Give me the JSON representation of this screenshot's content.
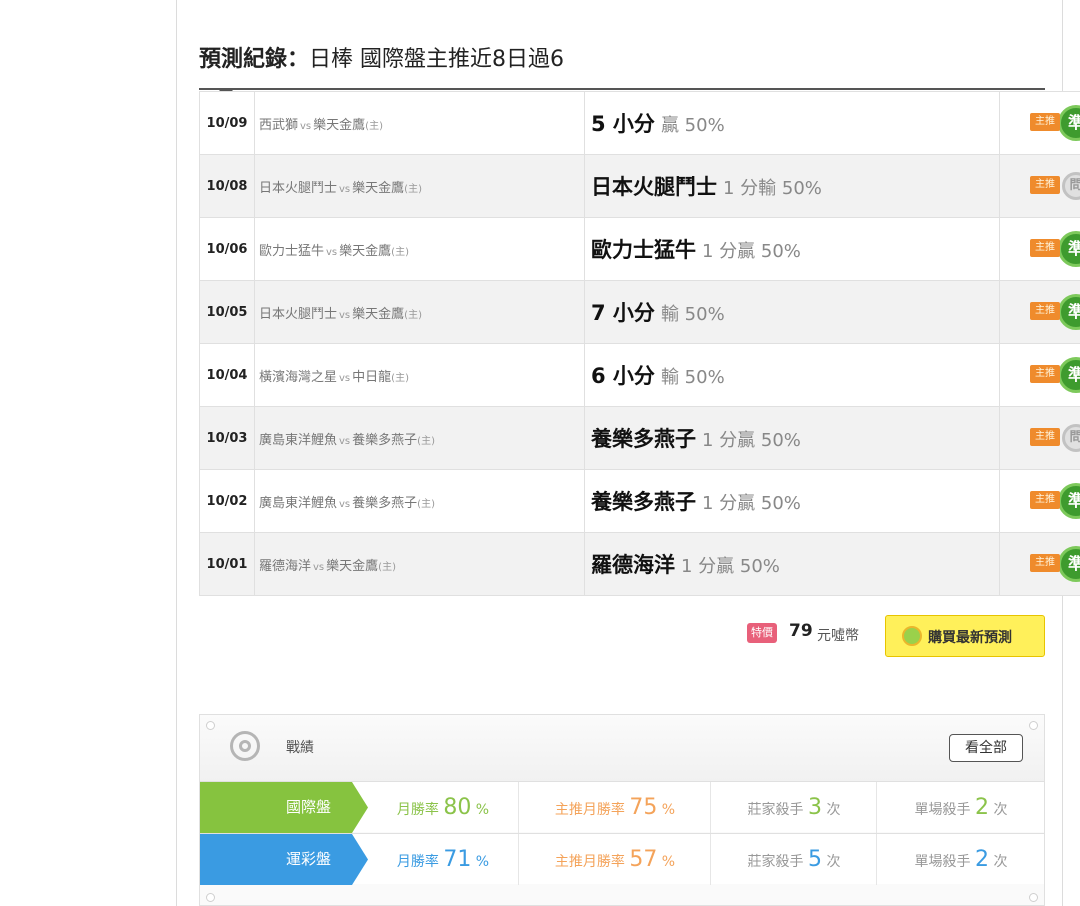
{
  "header": {
    "label": "預測紀錄：",
    "text": "日棒 國際盤主推近8日過6"
  },
  "records": [
    {
      "date": "10/09",
      "away": "西武獅",
      "vs": "vs",
      "home": "樂天金鷹",
      "home_mark": "(主)",
      "pick": "5 小分",
      "detail": "贏 50%",
      "tag": "主推",
      "result": "準",
      "result_type": "win"
    },
    {
      "date": "10/08",
      "away": "日本火腿鬥士",
      "vs": "vs",
      "home": "樂天金鷹",
      "home_mark": "(主)",
      "pick": "日本火腿鬥士",
      "detail": "1 分輸 50%",
      "tag": "主推",
      "result": "問",
      "result_type": "push"
    },
    {
      "date": "10/06",
      "away": "歐力士猛牛",
      "vs": "vs",
      "home": "樂天金鷹",
      "home_mark": "(主)",
      "pick": "歐力士猛牛",
      "detail": "1 分贏 50%",
      "tag": "主推",
      "result": "準",
      "result_type": "win"
    },
    {
      "date": "10/05",
      "away": "日本火腿鬥士",
      "vs": "vs",
      "home": "樂天金鷹",
      "home_mark": "(主)",
      "pick": "7 小分",
      "detail": "輸 50%",
      "tag": "主推",
      "result": "準",
      "result_type": "win"
    },
    {
      "date": "10/04",
      "away": "橫濱海灣之星",
      "vs": "vs",
      "home": "中日龍",
      "home_mark": "(主)",
      "pick": "6 小分",
      "detail": "輸 50%",
      "tag": "主推",
      "result": "準",
      "result_type": "win"
    },
    {
      "date": "10/03",
      "away": "廣島東洋鯉魚",
      "vs": "vs",
      "home": "養樂多燕子",
      "home_mark": "(主)",
      "pick": "養樂多燕子",
      "detail": "1 分贏 50%",
      "tag": "主推",
      "result": "問",
      "result_type": "push"
    },
    {
      "date": "10/02",
      "away": "廣島東洋鯉魚",
      "vs": "vs",
      "home": "養樂多燕子",
      "home_mark": "(主)",
      "pick": "養樂多燕子",
      "detail": "1 分贏 50%",
      "tag": "主推",
      "result": "準",
      "result_type": "win"
    },
    {
      "date": "10/01",
      "away": "羅德海洋",
      "vs": "vs",
      "home": "樂天金鷹",
      "home_mark": "(主)",
      "pick": "羅德海洋",
      "detail": "1 分贏 50%",
      "tag": "主推",
      "result": "準",
      "result_type": "win"
    }
  ],
  "purchase": {
    "special_badge": "特價",
    "price": "79",
    "unit": "元噓幣",
    "button_label": "購買最新預測"
  },
  "stats": {
    "title": "戰績",
    "view_all": "看全部",
    "rows": [
      {
        "type": "國際盤",
        "month_label": "月勝率",
        "month_value": "80",
        "main_label": "主推月勝率",
        "main_value": "75",
        "pct": "%",
        "dealer_label": "莊家殺手",
        "dealer_value": "3",
        "single_label": "單場殺手",
        "single_value": "2",
        "times": "次"
      },
      {
        "type": "運彩盤",
        "month_label": "月勝率",
        "month_value": "71",
        "main_label": "主推月勝率",
        "main_value": "57",
        "pct": "%",
        "dealer_label": "莊家殺手",
        "dealer_value": "5",
        "single_label": "單場殺手",
        "single_value": "2",
        "times": "次"
      }
    ]
  }
}
